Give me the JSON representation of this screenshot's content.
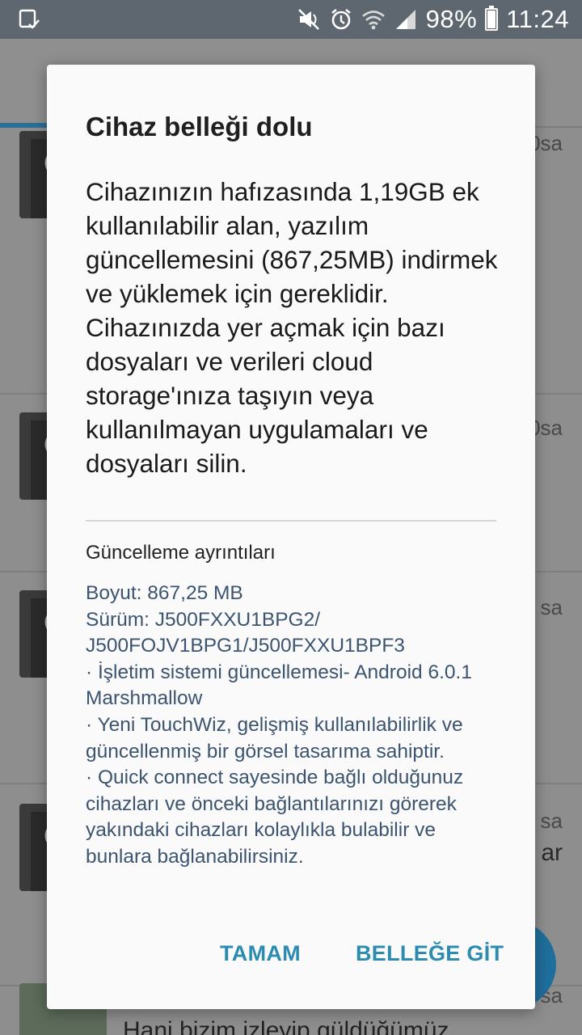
{
  "status_bar": {
    "battery_percent": "98%",
    "time": "11:24",
    "icons": [
      "screenshot-icon",
      "mute-icon",
      "alarm-icon",
      "wifi-icon",
      "signal-icon",
      "battery-icon"
    ]
  },
  "background": {
    "side_labels": [
      "0sa",
      "0sa",
      "sa",
      "sa",
      "sa"
    ],
    "side_extra": "ar",
    "bottom_text": "Hani bizim izleyip güldüğümüz"
  },
  "dialog": {
    "title": "Cihaz belleği dolu",
    "message": "Cihazınızın hafızasında 1,19GB ek kullanılabilir alan, yazılım güncellemesini (867,25MB) indirmek ve yüklemek için gereklidir. Cihazınızda yer açmak için bazı dosyaları ve verileri cloud storage'ınıza taşıyın veya kullanılmayan uygulamaları ve dosyaları silin.",
    "details_title": "Güncelleme ayrıntıları",
    "details": [
      "Boyut: 867,25 MB",
      "Sürüm: J500FXXU1BPG2/",
      "J500FOJV1BPG1/J500FXXU1BPF3",
      "· İşletim sistemi güncellemesi- Android 6.0.1 Marshmallow",
      "· Yeni TouchWiz, gelişmiş kullanılabilirlik ve güncellenmiş bir görsel tasarıma sahiptir.",
      "· Quick connect sayesinde bağlı olduğunuz cihazları ve önceki bağlantılarınızı görerek yakındaki cihazları kolaylıkla bulabilir ve bunlara bağlanabilirsiniz."
    ],
    "ok_label": "TAMAM",
    "go_label": "BELLEĞE GİT"
  }
}
